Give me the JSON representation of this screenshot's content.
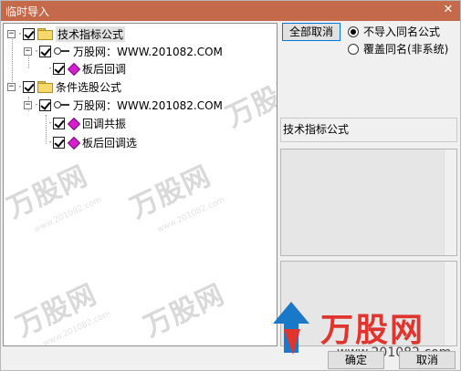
{
  "window": {
    "title": "临时导入",
    "close_glyph": "✕"
  },
  "tree": {
    "nodes": [
      {
        "label": "技术指标公式",
        "expander": "−",
        "selected": true
      },
      {
        "label": "万股网：WWW.201082.COM",
        "expander": "−"
      },
      {
        "label": "板后回调"
      },
      {
        "label": "条件选股公式",
        "expander": "−"
      },
      {
        "label": "万股网：WWW.201082.COM",
        "expander": "−"
      },
      {
        "label": "回调共振"
      },
      {
        "label": "板后回调选"
      }
    ]
  },
  "options": {
    "cancel_all_label": "全部取消",
    "radio_skip_label": "不导入同名公式",
    "radio_overwrite_label": "覆盖同名(非系统)",
    "selected_radio": "skip"
  },
  "info": {
    "category_label": "技术指标公式"
  },
  "buttons": {
    "ok_label": "确定",
    "cancel_label": "取消"
  },
  "watermark": {
    "brand": "万股网",
    "url": "www.201082.com"
  },
  "colors": {
    "titlebar": "#c4694a",
    "brand_red": "#e0342f",
    "formula_icon": "#d81dd0",
    "folder": "#f6d96a"
  },
  "icons": [
    "folder-icon",
    "key-icon",
    "formula-icon",
    "close-icon",
    "checkbox-checked",
    "radio-selected"
  ]
}
